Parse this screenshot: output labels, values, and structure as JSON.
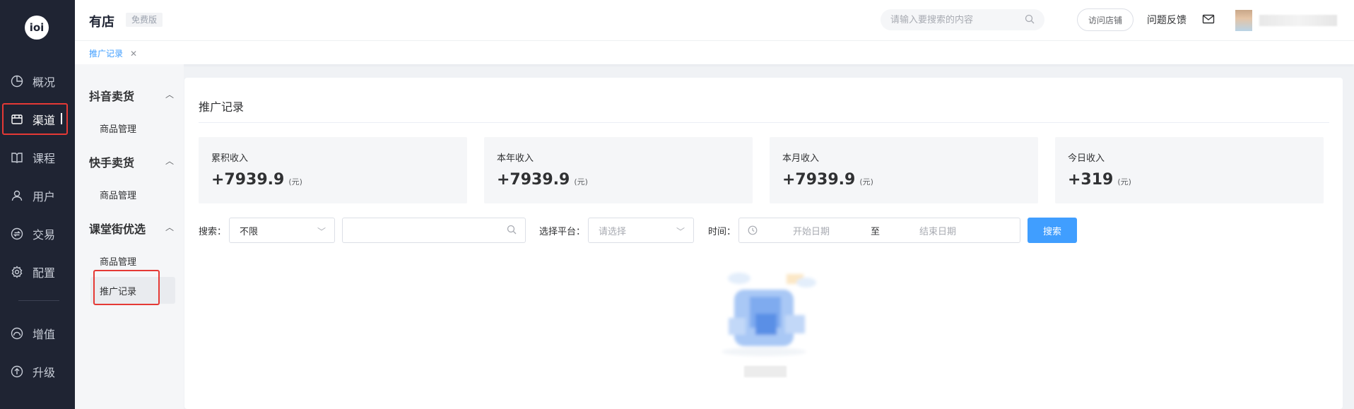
{
  "rail": {
    "logo_text": "ioi",
    "nav": [
      {
        "label": "概况",
        "icon": "pie-chart-icon"
      },
      {
        "label": "渠道",
        "icon": "store-icon",
        "active": true
      },
      {
        "label": "课程",
        "icon": "book-icon"
      },
      {
        "label": "用户",
        "icon": "user-icon"
      },
      {
        "label": "交易",
        "icon": "exchange-icon"
      },
      {
        "label": "配置",
        "icon": "gear-icon"
      }
    ],
    "nav2": [
      {
        "label": "增值",
        "icon": "gauge-icon"
      },
      {
        "label": "升级",
        "icon": "arrow-up-circle-icon"
      }
    ]
  },
  "header": {
    "brand": "有店",
    "badge": "免费版",
    "search_placeholder": "请输入要搜索的内容",
    "visit_store": "访问店铺",
    "feedback": "问题反馈"
  },
  "tabs": [
    {
      "label": "推广记录",
      "closable": true
    }
  ],
  "sidebar": {
    "groups": [
      {
        "title": "抖音卖货",
        "items": [
          "商品管理"
        ]
      },
      {
        "title": "快手卖货",
        "items": [
          "商品管理"
        ]
      },
      {
        "title": "课堂街优选",
        "items": [
          "商品管理",
          "推广记录"
        ]
      }
    ],
    "active_item": "推广记录"
  },
  "main": {
    "title": "推广记录",
    "stats": [
      {
        "label": "累积收入",
        "value": "+7939.9",
        "unit": "(元)"
      },
      {
        "label": "本年收入",
        "value": "+7939.9",
        "unit": "(元)"
      },
      {
        "label": "本月收入",
        "value": "+7939.9",
        "unit": "(元)"
      },
      {
        "label": "今日收入",
        "value": "+319",
        "unit": "(元)"
      }
    ],
    "filters": {
      "search_label": "搜索：",
      "search_type_value": "不限",
      "keyword_value": "",
      "platform_label": "选择平台：",
      "platform_placeholder": "请选择",
      "time_label": "时间：",
      "start_placeholder": "开始日期",
      "range_sep": "至",
      "end_placeholder": "结束日期",
      "search_button": "搜索"
    }
  },
  "colors": {
    "rail_bg": "#1f2433",
    "primary": "#409eff",
    "highlight": "#e53935"
  }
}
